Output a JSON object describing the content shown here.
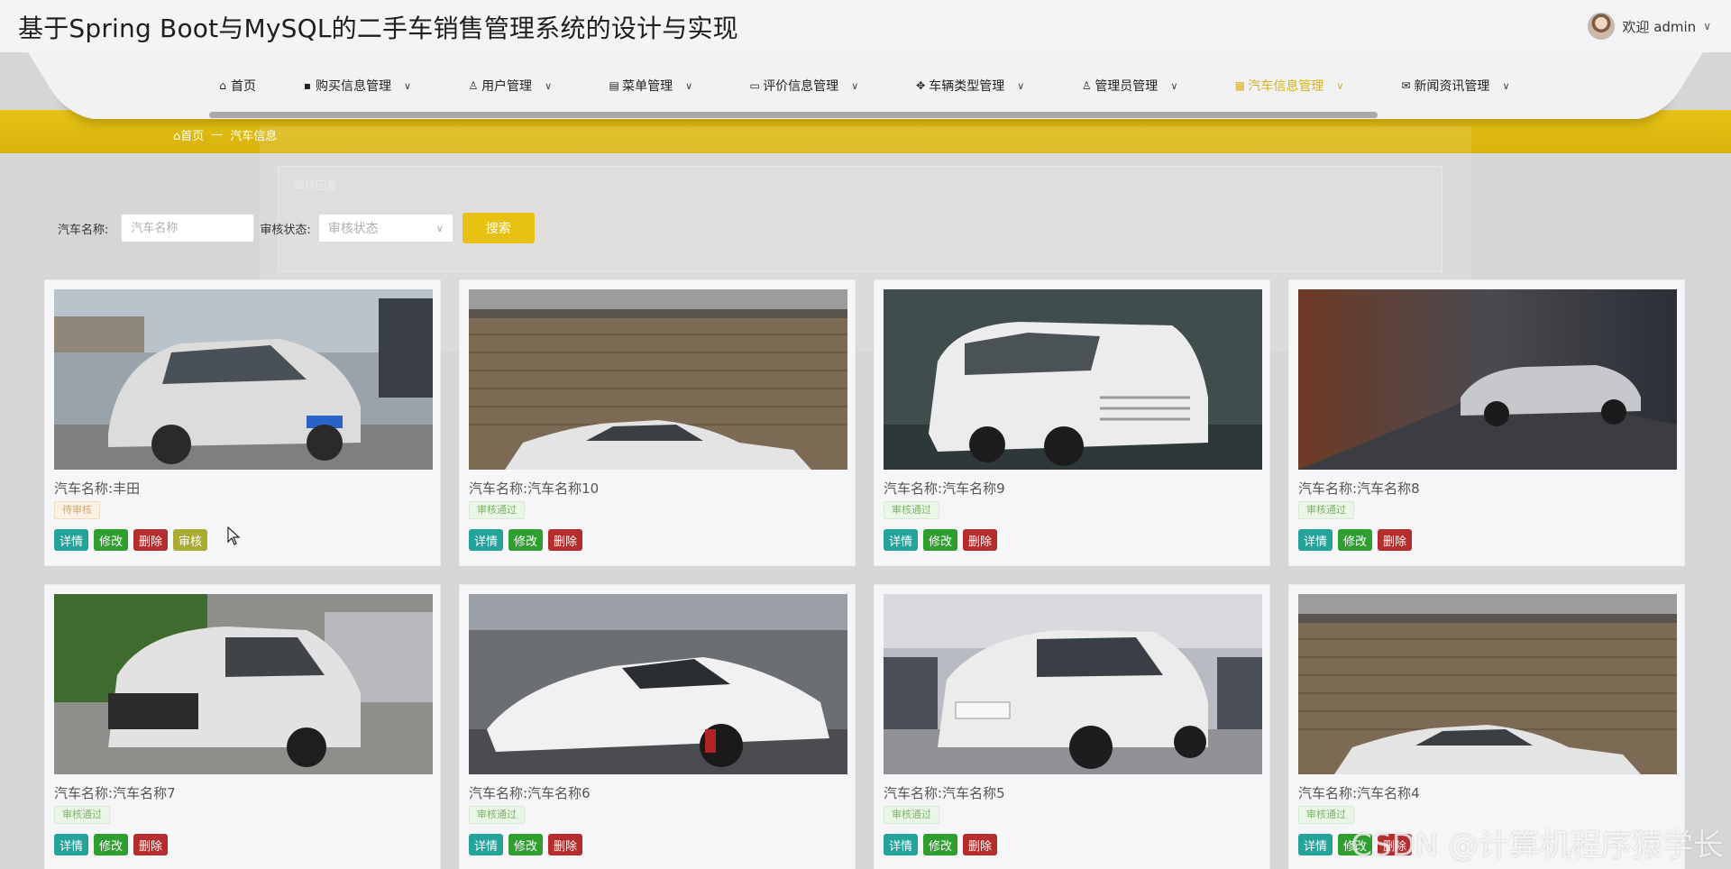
{
  "header": {
    "title": "基于Spring Boot与MySQL的二手车销售管理系统的设计与实现",
    "welcome": "欢迎 admin"
  },
  "nav": {
    "items": [
      {
        "label": "首页",
        "icon": "home-icon",
        "has_dropdown": false,
        "active": false
      },
      {
        "label": "购买信息管理",
        "icon": "bag-icon",
        "has_dropdown": true,
        "active": false
      },
      {
        "label": "用户管理",
        "icon": "user-icon",
        "has_dropdown": true,
        "active": false
      },
      {
        "label": "菜单管理",
        "icon": "menu-icon",
        "has_dropdown": true,
        "active": false
      },
      {
        "label": "评价信息管理",
        "icon": "card-icon",
        "has_dropdown": true,
        "active": false
      },
      {
        "label": "车辆类型管理",
        "icon": "grid-icon",
        "has_dropdown": true,
        "active": false
      },
      {
        "label": "管理员管理",
        "icon": "user-icon",
        "has_dropdown": true,
        "active": false
      },
      {
        "label": "汽车信息管理",
        "icon": "apps-icon",
        "has_dropdown": true,
        "active": true
      },
      {
        "label": "新闻资讯管理",
        "icon": "mail-icon",
        "has_dropdown": true,
        "active": false
      }
    ],
    "active_color": "#d8b414"
  },
  "breadcrumb": {
    "home": "首页",
    "separator": "—",
    "current": "汽车信息"
  },
  "ghost_panel": {
    "text": "审核回复"
  },
  "search": {
    "name_label": "汽车名称:",
    "name_placeholder": "汽车名称",
    "status_label": "审核状态:",
    "status_placeholder": "审核状态",
    "button": "搜索"
  },
  "card_labels": {
    "name_prefix": "汽车名称:",
    "detail": "详情",
    "edit": "修改",
    "delete": "删除",
    "audit": "审核"
  },
  "cards": [
    {
      "name": "丰田",
      "status": "待审核",
      "status_type": "pending",
      "show_audit": true,
      "photo": "silver-suv"
    },
    {
      "name": "汽车名称10",
      "status": "审核通过",
      "status_type": "passed",
      "show_audit": false,
      "photo": "classic-coupe"
    },
    {
      "name": "汽车名称9",
      "status": "审核通过",
      "status_type": "passed",
      "show_audit": false,
      "photo": "white-mpv"
    },
    {
      "name": "汽车名称8",
      "status": "审核通过",
      "status_type": "passed",
      "show_audit": false,
      "photo": "silver-roadster"
    },
    {
      "name": "汽车名称7",
      "status": "审核通过",
      "status_type": "passed",
      "show_audit": false,
      "photo": "white-suv"
    },
    {
      "name": "汽车名称6",
      "status": "审核通过",
      "status_type": "passed",
      "show_audit": false,
      "photo": "white-supercar"
    },
    {
      "name": "汽车名称5",
      "status": "审核通过",
      "status_type": "passed",
      "show_audit": false,
      "photo": "white-crossover"
    },
    {
      "name": "汽车名称4",
      "status": "审核通过",
      "status_type": "passed",
      "show_audit": false,
      "photo": "classic-coupe"
    }
  ],
  "watermark": "CSDN @计算机程序猿学长",
  "colors": {
    "accent_yellow": "#e7c112",
    "detail_button": "#24a39b",
    "edit_button": "#2e9f2e",
    "delete_button": "#b52d2d",
    "audit_button": "#a9ab35"
  }
}
